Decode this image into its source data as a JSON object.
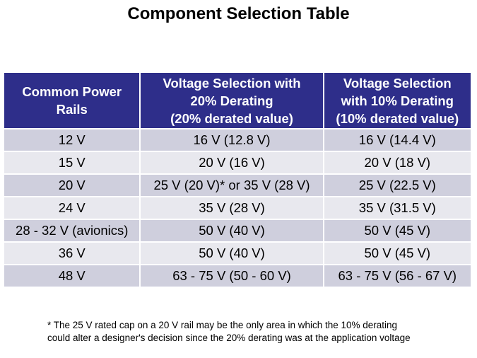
{
  "title": "Component Selection Table",
  "table": {
    "headers": [
      [
        "Common Power",
        "Rails"
      ],
      [
        "Voltage Selection with",
        "20% Derating",
        "(20% derated value)"
      ],
      [
        "Voltage Selection",
        "with 10% Derating",
        "(10% derated value)"
      ]
    ],
    "rows": [
      [
        "12 V",
        "16 V (12.8 V)",
        "16 V (14.4 V)"
      ],
      [
        "15 V",
        "20 V (16 V)",
        "20 V (18 V)"
      ],
      [
        "20 V",
        "25 V (20 V)* or 35 V (28 V)",
        "25 V (22.5 V)"
      ],
      [
        "24 V",
        "35 V (28 V)",
        "35 V (31.5 V)"
      ],
      [
        "28 - 32 V (avionics)",
        "50 V (40 V)",
        "50 V (45 V)"
      ],
      [
        "36 V",
        "50 V (40 V)",
        "50 V (45 V)"
      ],
      [
        "48 V",
        "63 - 75 V (50 - 60 V)",
        "63 - 75 V (56 - 67 V)"
      ]
    ]
  },
  "footnote": [
    "* The 25 V rated cap on a 20 V rail may be the only area in which the 10% derating",
    "could alter a designer's decision since the 20% derating was at the application voltage"
  ],
  "colors": {
    "header_bg": "#2e2e8a",
    "row_dark": "#cfcfdd",
    "row_light": "#e8e8ee"
  }
}
